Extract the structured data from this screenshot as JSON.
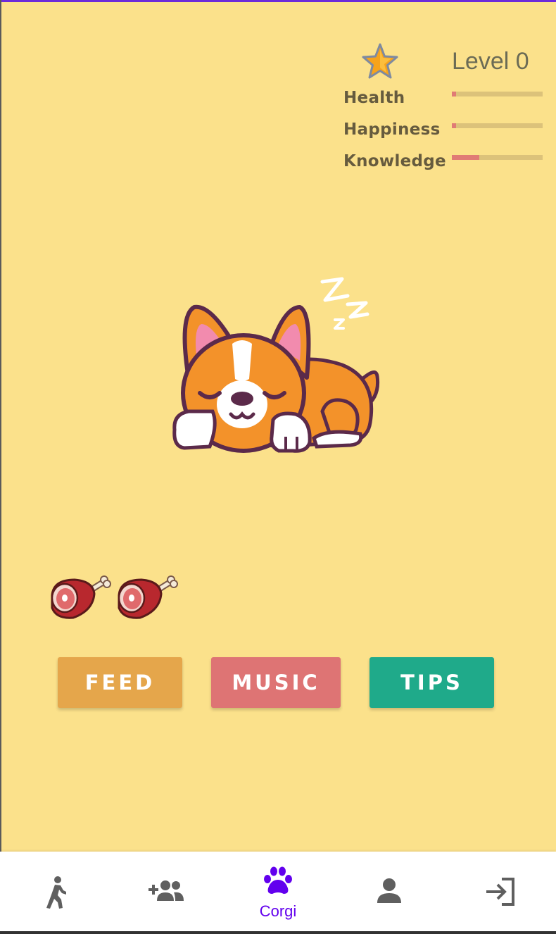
{
  "header": {
    "level_text": "Level 0",
    "star_icon": "star-icon"
  },
  "stats": [
    {
      "label": "Health",
      "value": 0.05
    },
    {
      "label": "Happiness",
      "value": 0.05
    },
    {
      "label": "Knowledge",
      "value": 0.3
    }
  ],
  "pet": {
    "illustration": "sleeping-corgi",
    "state_icon": "zzz-icon"
  },
  "food": {
    "count": 2,
    "icon": "meat-icon"
  },
  "actions": {
    "feed_label": "FEED",
    "music_label": "MUSIC",
    "tips_label": "TIPS"
  },
  "colors": {
    "background": "#fbe18b",
    "feed": "#e5a64b",
    "music": "#de7474",
    "tips": "#1faa8a",
    "accent": "#6200ee",
    "bar_fill": "#e07b75",
    "bar_track": "#dcc27a"
  },
  "nav": {
    "items": [
      {
        "icon": "walk-icon",
        "label": ""
      },
      {
        "icon": "add-friend-icon",
        "label": ""
      },
      {
        "icon": "paw-icon",
        "label": "Corgi",
        "active": true
      },
      {
        "icon": "person-icon",
        "label": ""
      },
      {
        "icon": "login-icon",
        "label": ""
      }
    ]
  }
}
